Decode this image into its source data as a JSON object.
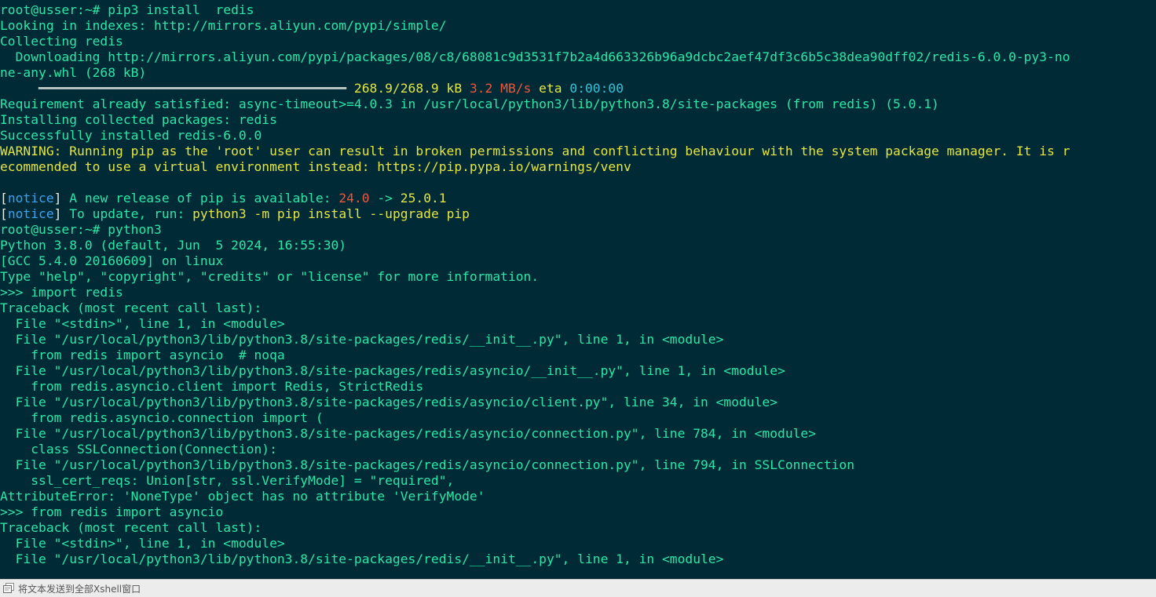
{
  "terminal": {
    "lines": [
      [
        {
          "t": "root@usser:~# pip3 install  redis",
          "c": "default"
        }
      ],
      [
        {
          "t": "Looking in indexes: http://mirrors.aliyun.com/pypi/simple/",
          "c": "default"
        }
      ],
      [
        {
          "t": "Collecting redis",
          "c": "default"
        }
      ],
      [
        {
          "t": "  Downloading http://mirrors.aliyun.com/pypi/packages/08/c8/68081c9d3531f7b2a4d663326b96a9dcbc2aef47df3c6b5c38dea90dff02/redis-6.0.0-py3-no",
          "c": "default"
        }
      ],
      [
        {
          "t": "ne-any.whl (268 kB)",
          "c": "default"
        }
      ],
      [
        {
          "t": "     ━━━━━━━━━━━━━━━━━━━━━━━━━━━━━━━━━━━━━━━━",
          "c": "bar"
        },
        {
          "t": " 268.9/268.9 kB ",
          "c": "yellow"
        },
        {
          "t": "3.2 MB/s",
          "c": "red"
        },
        {
          "t": " eta ",
          "c": "yellow"
        },
        {
          "t": "0:00:00",
          "c": "cyan"
        }
      ],
      [
        {
          "t": "Requirement already satisfied: async-timeout>=4.0.3 in /usr/local/python3/lib/python3.8/site-packages (from redis) (5.0.1)",
          "c": "default"
        }
      ],
      [
        {
          "t": "Installing collected packages: redis",
          "c": "default"
        }
      ],
      [
        {
          "t": "Successfully installed redis-6.0.0",
          "c": "default"
        }
      ],
      [
        {
          "t": "WARNING: Running pip as the 'root' user can result in broken permissions and conflicting behaviour with the system package manager. It is r",
          "c": "yellow"
        }
      ],
      [
        {
          "t": "ecommended to use a virtual environment instead: https://pip.pypa.io/warnings/venv",
          "c": "yellow"
        }
      ],
      [
        {
          "t": "",
          "c": "default"
        }
      ],
      [
        {
          "t": "[",
          "c": "white"
        },
        {
          "t": "notice",
          "c": "blue"
        },
        {
          "t": "]",
          "c": "white"
        },
        {
          "t": " A new release of pip is available: ",
          "c": "default"
        },
        {
          "t": "24.0",
          "c": "red"
        },
        {
          "t": " -> ",
          "c": "default"
        },
        {
          "t": "25.0.1",
          "c": "yellow"
        }
      ],
      [
        {
          "t": "[",
          "c": "white"
        },
        {
          "t": "notice",
          "c": "blue"
        },
        {
          "t": "]",
          "c": "white"
        },
        {
          "t": " To update, run: ",
          "c": "default"
        },
        {
          "t": "python3 -m pip install --upgrade pip",
          "c": "yellow"
        }
      ],
      [
        {
          "t": "root@usser:~# python3",
          "c": "default"
        }
      ],
      [
        {
          "t": "Python 3.8.0 (default, Jun  5 2024, 16:55:30)",
          "c": "default"
        }
      ],
      [
        {
          "t": "[GCC 5.4.0 20160609] on linux",
          "c": "default"
        }
      ],
      [
        {
          "t": "Type \"help\", \"copyright\", \"credits\" or \"license\" for more information.",
          "c": "default"
        }
      ],
      [
        {
          "t": ">>> import redis",
          "c": "default"
        }
      ],
      [
        {
          "t": "Traceback (most recent call last):",
          "c": "default"
        }
      ],
      [
        {
          "t": "  File \"<stdin>\", line 1, in <module>",
          "c": "default"
        }
      ],
      [
        {
          "t": "  File \"/usr/local/python3/lib/python3.8/site-packages/redis/__init__.py\", line 1, in <module>",
          "c": "default"
        }
      ],
      [
        {
          "t": "    from redis import asyncio  # noqa",
          "c": "default"
        }
      ],
      [
        {
          "t": "  File \"/usr/local/python3/lib/python3.8/site-packages/redis/asyncio/__init__.py\", line 1, in <module>",
          "c": "default"
        }
      ],
      [
        {
          "t": "    from redis.asyncio.client import Redis, StrictRedis",
          "c": "default"
        }
      ],
      [
        {
          "t": "  File \"/usr/local/python3/lib/python3.8/site-packages/redis/asyncio/client.py\", line 34, in <module>",
          "c": "default"
        }
      ],
      [
        {
          "t": "    from redis.asyncio.connection import (",
          "c": "default"
        }
      ],
      [
        {
          "t": "  File \"/usr/local/python3/lib/python3.8/site-packages/redis/asyncio/connection.py\", line 784, in <module>",
          "c": "default"
        }
      ],
      [
        {
          "t": "    class SSLConnection(Connection):",
          "c": "default"
        }
      ],
      [
        {
          "t": "  File \"/usr/local/python3/lib/python3.8/site-packages/redis/asyncio/connection.py\", line 794, in SSLConnection",
          "c": "default"
        }
      ],
      [
        {
          "t": "    ssl_cert_reqs: Union[str, ssl.VerifyMode] = \"required\",",
          "c": "default"
        }
      ],
      [
        {
          "t": "AttributeError: 'NoneType' object has no attribute 'VerifyMode'",
          "c": "default"
        }
      ],
      [
        {
          "t": ">>> from redis import asyncio",
          "c": "default"
        }
      ],
      [
        {
          "t": "Traceback (most recent call last):",
          "c": "default"
        }
      ],
      [
        {
          "t": "  File \"<stdin>\", line 1, in <module>",
          "c": "default"
        }
      ],
      [
        {
          "t": "  File \"/usr/local/python3/lib/python3.8/site-packages/redis/__init__.py\", line 1, in <module>",
          "c": "default"
        }
      ]
    ]
  },
  "statusbar": {
    "icon": "send-to-all-sessions-icon",
    "label": "将文本发送到全部Xshell窗口"
  },
  "colors": {
    "background": "#002b36",
    "default": "#2ce6a8",
    "yellow": "#e5e542",
    "red": "#f1553a",
    "cyan": "#34c1d8",
    "blue": "#3ba2f0",
    "white": "#e8f0e8",
    "statusbar_bg": "#ececec"
  }
}
